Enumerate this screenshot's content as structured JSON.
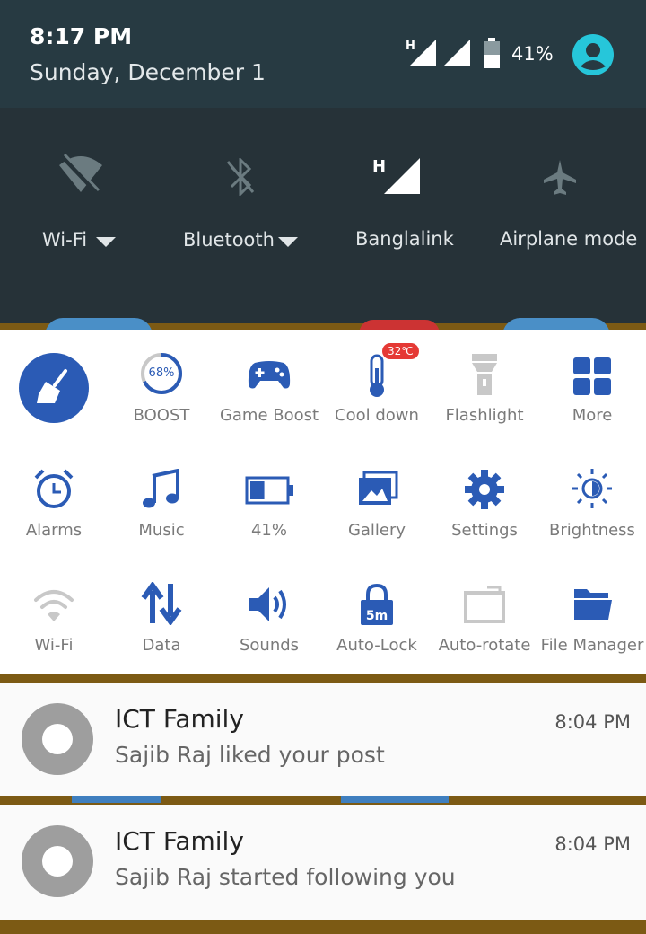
{
  "status_bar": {
    "time": "8:17 PM",
    "date": "Sunday, December 1",
    "signal_type": "H",
    "battery": "41%",
    "colors": {
      "background": "#273a42",
      "avatar": "#26c6da"
    }
  },
  "quick_settings": [
    {
      "label": "Wi-Fi",
      "icon": "wifi-off-icon",
      "has_dropdown": true
    },
    {
      "label": "Bluetooth",
      "icon": "bluetooth-off-icon",
      "has_dropdown": true
    },
    {
      "label": "Banglalink",
      "icon": "cell-signal-icon",
      "signal_type": "H"
    },
    {
      "label": "Airplane mode",
      "icon": "airplane-icon"
    }
  ],
  "toolbox": {
    "cleaner_icon": "broom-icon",
    "rows": [
      [
        {
          "label": "BOOST",
          "icon": "boost-ring-icon",
          "value": "68%",
          "fraction": 0.68
        },
        {
          "label": "Game Boost",
          "icon": "gamepad-icon"
        },
        {
          "label": "Cool down",
          "icon": "thermometer-icon",
          "badge": "32℃"
        },
        {
          "label": "Flashlight",
          "icon": "flashlight-icon"
        },
        {
          "label": "More",
          "icon": "grid-icon"
        }
      ],
      [
        {
          "label": "Alarms",
          "icon": "alarm-clock-icon"
        },
        {
          "label": "Music",
          "icon": "music-note-icon"
        },
        {
          "label": "41%",
          "icon": "battery-icon",
          "fraction": 0.41
        },
        {
          "label": "Gallery",
          "icon": "gallery-icon"
        },
        {
          "label": "Settings",
          "icon": "gear-icon"
        },
        {
          "label": "Brightness",
          "icon": "brightness-icon"
        }
      ],
      [
        {
          "label": "Wi-Fi",
          "icon": "wifi-icon"
        },
        {
          "label": "Data",
          "icon": "data-arrows-icon"
        },
        {
          "label": "Sounds",
          "icon": "speaker-icon"
        },
        {
          "label": "Auto-Lock",
          "icon": "lock-icon",
          "value": "5m"
        },
        {
          "label": "Auto-rotate",
          "icon": "rotate-icon"
        },
        {
          "label": "File Manager",
          "icon": "folder-icon"
        }
      ]
    ],
    "colors": {
      "accent": "#2b5bb5",
      "disabled": "#c8c8c8",
      "badge": "#e53935"
    }
  },
  "notifications": [
    {
      "app": "ICT Family",
      "text": "Sajib Raj liked your post",
      "time": "8:04 PM"
    },
    {
      "app": "ICT Family",
      "text": "Sajib Raj started following you",
      "time": "8:04 PM"
    }
  ]
}
